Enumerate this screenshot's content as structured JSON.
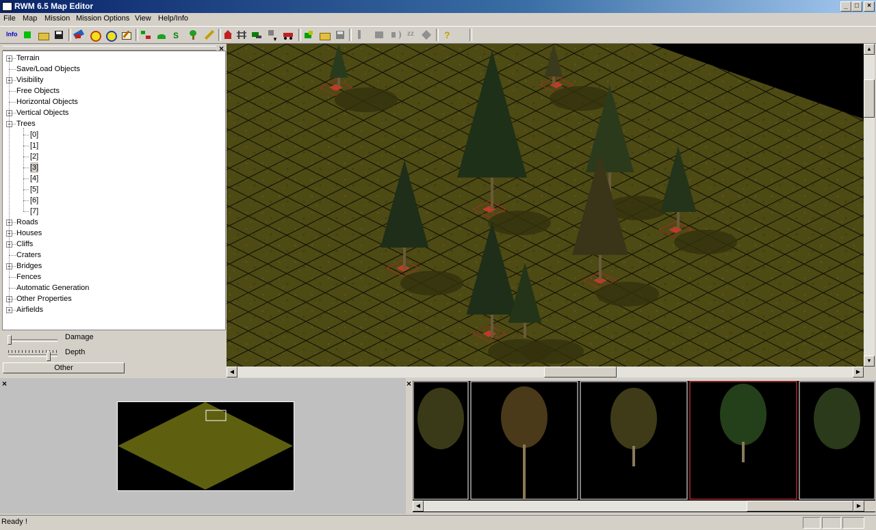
{
  "window": {
    "title": "RWM 6.5 Map Editor",
    "controls": [
      "_",
      "□",
      "×"
    ]
  },
  "menu": [
    "File",
    "Map",
    "Mission",
    "Mission Options",
    "View",
    "Help/Info"
  ],
  "toolbar": {
    "info_label": "Info"
  },
  "tree": {
    "close_glyph": "×",
    "items": [
      {
        "label": "Terrain",
        "expandable": true
      },
      {
        "label": "Save/Load Objects",
        "expandable": false
      },
      {
        "label": "Visibility",
        "expandable": true
      },
      {
        "label": "Free Objects",
        "expandable": false
      },
      {
        "label": "Horizontal Objects",
        "expandable": false
      },
      {
        "label": "Vertical Objects",
        "expandable": true
      },
      {
        "label": "Trees",
        "expandable": true,
        "expanded": true
      },
      {
        "label": "[0]"
      },
      {
        "label": "[1]"
      },
      {
        "label": "[2]"
      },
      {
        "label": "[3]",
        "selected": true
      },
      {
        "label": "[4]"
      },
      {
        "label": "[5]"
      },
      {
        "label": "[6]"
      },
      {
        "label": "[7]"
      },
      {
        "label": "Roads",
        "expandable": true
      },
      {
        "label": "Houses",
        "expandable": true
      },
      {
        "label": "Cliffs",
        "expandable": true
      },
      {
        "label": "Craters",
        "expandable": false
      },
      {
        "label": "Bridges",
        "expandable": true
      },
      {
        "label": "Fences",
        "expandable": false
      },
      {
        "label": "Automatic Generation",
        "expandable": false
      },
      {
        "label": "Other Properties",
        "expandable": true
      },
      {
        "label": "Airfields",
        "expandable": true
      }
    ]
  },
  "controls": {
    "damage_label": "Damage",
    "depth_label": "Depth",
    "other_button": "Other",
    "damage_level": 0.0,
    "depth_level": 0.82
  },
  "panels": {
    "minimap_close": "×",
    "preview_close": "×"
  },
  "colors": {
    "terrain": "#4d4a14",
    "minimap_terrain": "#5e6010",
    "selection": "#ff4040"
  },
  "status": {
    "text": "Ready !"
  }
}
